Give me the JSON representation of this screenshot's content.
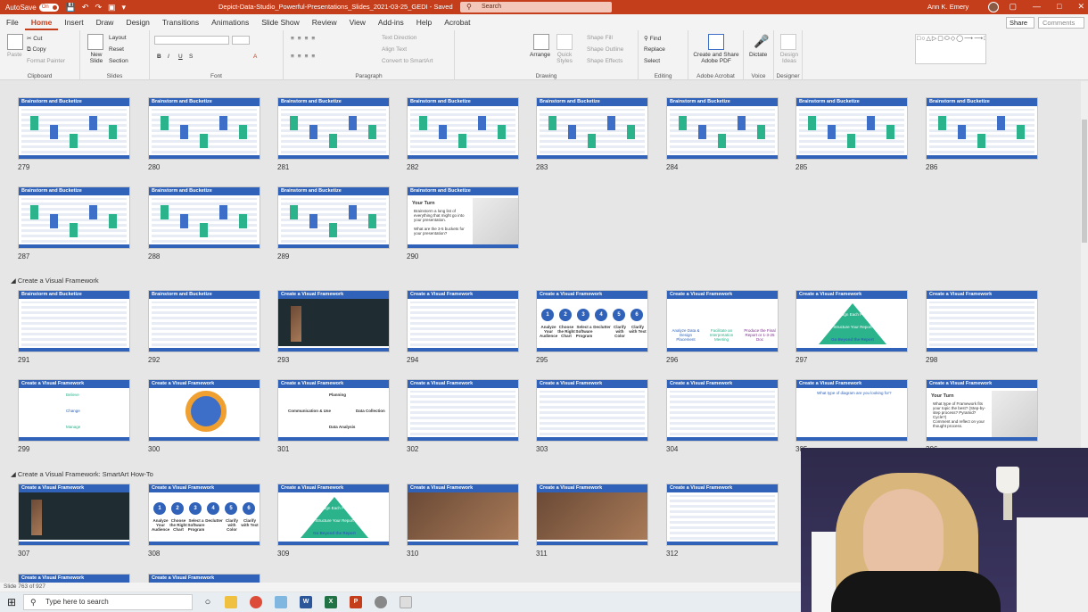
{
  "titlebar": {
    "autosave_label": "AutoSave",
    "autosave_state": "On",
    "doc_title": "Depict-Data-Studio_Powerful-Presentations_Slides_2021-03-25_GEDI  -  Saved",
    "search_placeholder": "Search",
    "user_name": "Ann K. Emery",
    "accent_color": "#c43e1c"
  },
  "tabs": [
    "File",
    "Home",
    "Insert",
    "Draw",
    "Design",
    "Transitions",
    "Animations",
    "Slide Show",
    "Review",
    "View",
    "Add-ins",
    "Help",
    "Acrobat"
  ],
  "active_tab": "Home",
  "share_label": "Share",
  "comments_label": "Comments",
  "ribbon": {
    "clipboard": {
      "paste": "Paste",
      "cut": "Cut",
      "copy": "Copy",
      "format_painter": "Format Painter",
      "label": "Clipboard"
    },
    "slides": {
      "new_slide": "New Slide",
      "layout": "Layout",
      "reset": "Reset",
      "section": "Section",
      "label": "Slides"
    },
    "font": {
      "label": "Font"
    },
    "paragraph": {
      "text_direction": "Text Direction",
      "align_text": "Align Text",
      "convert": "Convert to SmartArt",
      "label": "Paragraph"
    },
    "drawing": {
      "arrange": "Arrange",
      "quick_styles": "Quick Styles",
      "shape_fill": "Shape Fill",
      "shape_outline": "Shape Outline",
      "shape_effects": "Shape Effects",
      "label": "Drawing"
    },
    "editing": {
      "find": "Find",
      "replace": "Replace",
      "select": "Select",
      "label": "Editing"
    },
    "acrobat": {
      "create": "Create and Share Adobe PDF",
      "label": "Adobe Acrobat"
    },
    "voice": {
      "dictate": "Dictate",
      "label": "Voice"
    },
    "designer": {
      "design_ideas": "Design Ideas",
      "label": "Designer"
    }
  },
  "sections": [
    "Create a Visual Framework",
    "Create a Visual Framework: SmartArt How-To"
  ],
  "slides": [
    {
      "num": "279",
      "title": "Brainstorm and Bucketize"
    },
    {
      "num": "280",
      "title": "Brainstorm and Bucketize"
    },
    {
      "num": "281",
      "title": "Brainstorm and Bucketize"
    },
    {
      "num": "282",
      "title": "Brainstorm and Bucketize"
    },
    {
      "num": "283",
      "title": "Brainstorm and Bucketize"
    },
    {
      "num": "284",
      "title": "Brainstorm and Bucketize"
    },
    {
      "num": "285",
      "title": "Brainstorm and Bucketize"
    },
    {
      "num": "286",
      "title": "Brainstorm and Bucketize"
    },
    {
      "num": "287",
      "title": "Brainstorm and Bucketize"
    },
    {
      "num": "288",
      "title": "Brainstorm and Bucketize"
    },
    {
      "num": "289",
      "title": "Brainstorm and Bucketize"
    },
    {
      "num": "290",
      "title": "Brainstorm and Bucketize",
      "body": "Your Turn",
      "b1": "Brainstorm a long list of everything that might go into your presentation.",
      "b2": "What are the 3-5 buckets for your presentation?"
    },
    {
      "num": "291",
      "title": "Brainstorm and Bucketize"
    },
    {
      "num": "292",
      "title": "Brainstorm and Bucketize"
    },
    {
      "num": "293",
      "title": "Create a Visual Framework"
    },
    {
      "num": "294",
      "title": "Create a Visual Framework"
    },
    {
      "num": "295",
      "title": "Create a Visual Framework",
      "steps": [
        "Analyze Your Audience",
        "Choose the Right Chart",
        "Select a Software Program",
        "Declutter",
        "Clarify with Color",
        "Clarify with Text"
      ]
    },
    {
      "num": "296",
      "title": "Create a Visual Framework",
      "t1": "Analyze Data & Design Placement",
      "t2": "Facilitate an Interpretation Meeting",
      "t3": "Produce the Final Report or 1-3-25 Doc"
    },
    {
      "num": "297",
      "title": "Create a Visual Framework",
      "p1": "Design Each Page",
      "p2": "Structure Your Report",
      "p3": "Go Beyond the Report"
    },
    {
      "num": "298",
      "title": "Create a Visual Framework"
    },
    {
      "num": "299",
      "title": "Create a Visual Framework",
      "v1": "Believe",
      "v2": "Change",
      "v3": "Manage"
    },
    {
      "num": "300",
      "title": "Create a Visual Framework"
    },
    {
      "num": "301",
      "title": "Create a Visual Framework",
      "c1": "Planning",
      "c2": "Data Collection",
      "c3": "Data Analysis",
      "c4": "Communication & Use"
    },
    {
      "num": "302",
      "title": "Create a Visual Framework"
    },
    {
      "num": "303",
      "title": "Create a Visual Framework"
    },
    {
      "num": "304",
      "title": "Create a Visual Framework"
    },
    {
      "num": "305",
      "title": "Create a Visual Framework",
      "q": "What type of diagram are you looking for?"
    },
    {
      "num": "306",
      "title": "Create a Visual Framework",
      "body": "Your Turn",
      "b1": "What type of Framework fits your topic the best? (Step-by-step process? Pyramid? Cycle?)",
      "b2": "Comment and reflect on your thought process."
    },
    {
      "num": "307",
      "title": "Create a Visual Framework"
    },
    {
      "num": "308",
      "title": "Create a Visual Framework",
      "steps": [
        "Analyze Your Audience",
        "Choose the Right Chart",
        "Select a Software Program",
        "Declutter",
        "Clarify with Color",
        "Clarify with Text"
      ]
    },
    {
      "num": "309",
      "title": "Create a Visual Framework",
      "p1": "Design Each Page",
      "p2": "Structure Your Report",
      "p3": "Go Beyond the Report"
    },
    {
      "num": "310",
      "title": "Create a Visual Framework"
    },
    {
      "num": "311",
      "title": "Create a Visual Framework"
    },
    {
      "num": "312",
      "title": "Create a Visual Framework"
    },
    {
      "num": "",
      "title": "Create a Visual Framework"
    },
    {
      "num": "",
      "title": "Create a Visual Framework"
    }
  ],
  "status": "Slide 763 of 927",
  "taskbar": {
    "search_placeholder": "Type here to search"
  }
}
